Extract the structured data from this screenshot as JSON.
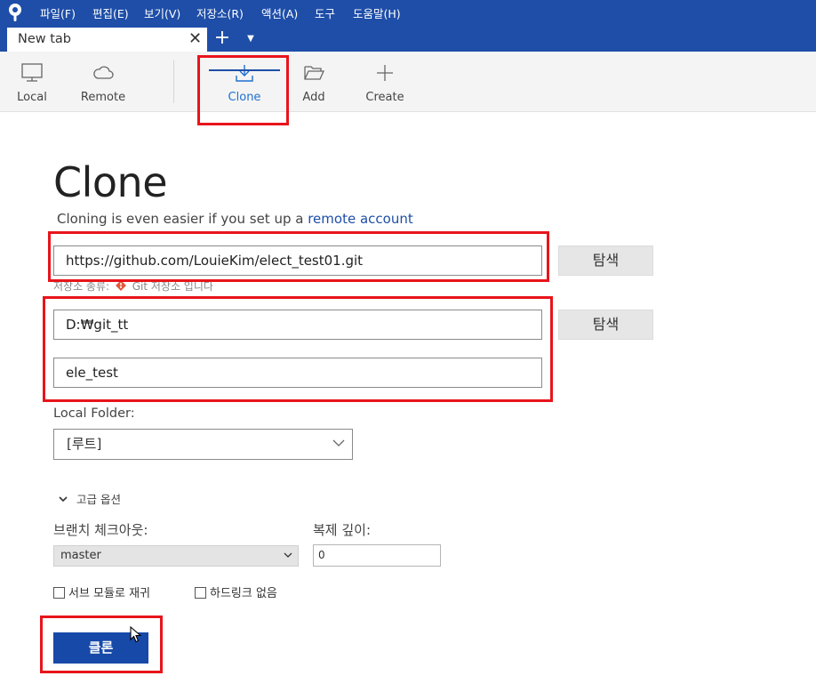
{
  "menu": [
    "파일(F)",
    "편집(E)",
    "보기(V)",
    "저장소(R)",
    "액션(A)",
    "도구",
    "도움말(H)"
  ],
  "tab": {
    "label": "New tab"
  },
  "toolbar": {
    "local": "Local",
    "remote": "Remote",
    "clone": "Clone",
    "add": "Add",
    "create": "Create"
  },
  "clone_page": {
    "title": "Clone",
    "subtitle_prefix": "Cloning is even easier if you set up a ",
    "subtitle_link": "remote account",
    "source_url": "https://github.com/LouieKim/elect_test01.git",
    "browse_label": "탐색",
    "repo_type_label": "저장소 종류:",
    "repo_type_value": "Git 저장소 입니다",
    "destination_path": "D:₩git_tt",
    "name": "ele_test",
    "local_folder_label": "Local Folder:",
    "local_folder_value": "[루트]",
    "advanced_label": "고급 옵션",
    "branch_label": "브랜치 체크아웃:",
    "branch_value": "master",
    "depth_label": "복제 깊이:",
    "depth_value": "0",
    "recurse_submodules_label": "서브 모듈로 재귀",
    "no_hardlinks_label": "하드링크 없음",
    "clone_button_label": "클론"
  },
  "colors": {
    "brand": "#1e4ea8",
    "highlight": "#e8141b",
    "button": "#1749a8"
  }
}
